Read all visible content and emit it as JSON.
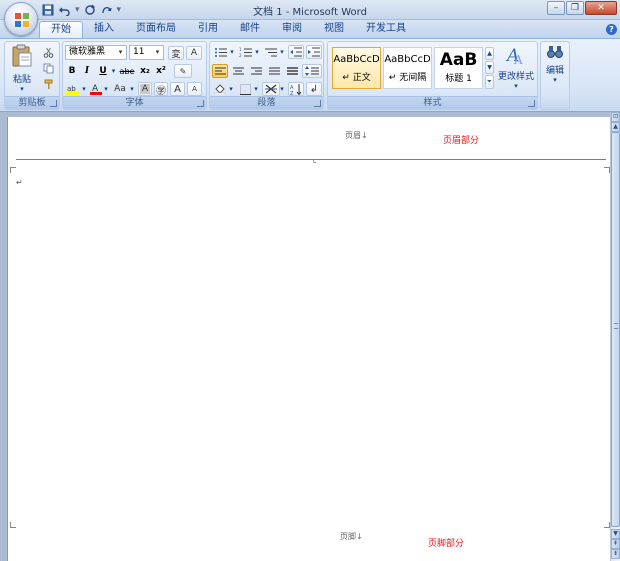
{
  "window": {
    "title": "文档 1 - Microsoft Word",
    "minimize_icon": "minimize-icon",
    "maximize_icon": "restore-icon",
    "close_icon": "close-icon"
  },
  "quick_access": {
    "save_icon": "save-icon",
    "undo_icon": "undo-icon",
    "redo_icon": "redo-icon",
    "customize_icon": "chevron-down-icon"
  },
  "tabs": [
    {
      "label": "开始",
      "active": true
    },
    {
      "label": "插入"
    },
    {
      "label": "页面布局"
    },
    {
      "label": "引用"
    },
    {
      "label": "邮件"
    },
    {
      "label": "审阅"
    },
    {
      "label": "视图"
    },
    {
      "label": "开发工具"
    }
  ],
  "ribbon": {
    "clipboard": {
      "label": "剪贴板",
      "paste_label": "粘贴"
    },
    "font": {
      "label": "字体",
      "font_name": "微软雅黑",
      "font_size": "11",
      "bold": "B",
      "italic": "I",
      "underline": "U",
      "strike": "abe",
      "subscript": "x₂",
      "superscript": "x²",
      "change_case": "Aa",
      "grow": "A",
      "shrink": "A"
    },
    "paragraph": {
      "label": "段落"
    },
    "styles": {
      "label": "样式",
      "items": [
        {
          "sample": "AaBbCcD",
          "name": "↵ 正文",
          "selected": true
        },
        {
          "sample": "AaBbCcD",
          "name": "↵ 无间隔"
        },
        {
          "sample": "AaB",
          "name": "标题 1"
        }
      ],
      "change_styles_label": "更改样式"
    },
    "editing": {
      "label": "编辑"
    }
  },
  "document": {
    "header_text": "页眉↓",
    "header_note": "页眉部分",
    "paragraph_mark": "↵",
    "footer_text": "页脚↓",
    "footer_note": "页脚部分"
  },
  "colors": {
    "note_red": "#e8141a",
    "highlight_yellow": "#ffff00",
    "font_color_red": "#ff0000"
  }
}
